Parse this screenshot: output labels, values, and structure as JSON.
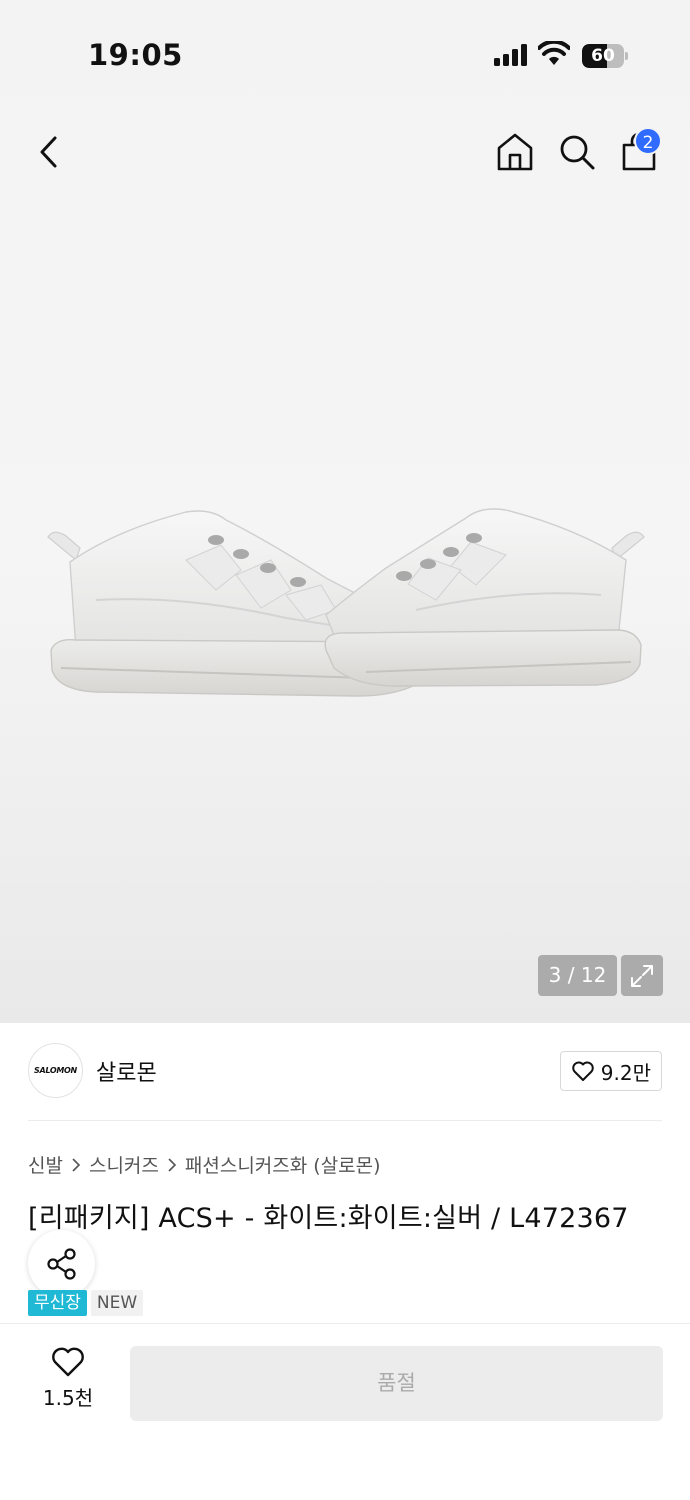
{
  "status_bar": {
    "time": "19:05",
    "battery_level": "60",
    "battery_fraction": 0.6
  },
  "nav": {
    "back_icon": "chevron-left-icon",
    "home_icon": "home-icon",
    "search_icon": "search-icon",
    "bag_icon": "shopping-bag-icon",
    "bag_badge_count": "2",
    "badge_color": "#2f6bff"
  },
  "gallery": {
    "counter": "3 / 12",
    "expand_icon": "expand-icon"
  },
  "brand": {
    "logo_text": "SALOMON",
    "name": "살로몬",
    "like_count": "9.2만"
  },
  "breadcrumb": [
    "신발",
    "스니커즈",
    "패션스니커즈화 (살로몬)"
  ],
  "product": {
    "title": "[리패키지] ACS+ - 화이트:화이트:실버 / L472367"
  },
  "tags": [
    {
      "label": "무신장",
      "color": "#1fb9d6"
    },
    {
      "label": "NEW",
      "color": "#f1f1f1"
    }
  ],
  "bottom_bar": {
    "like_count": "1.5천",
    "soldout_label": "품절"
  }
}
